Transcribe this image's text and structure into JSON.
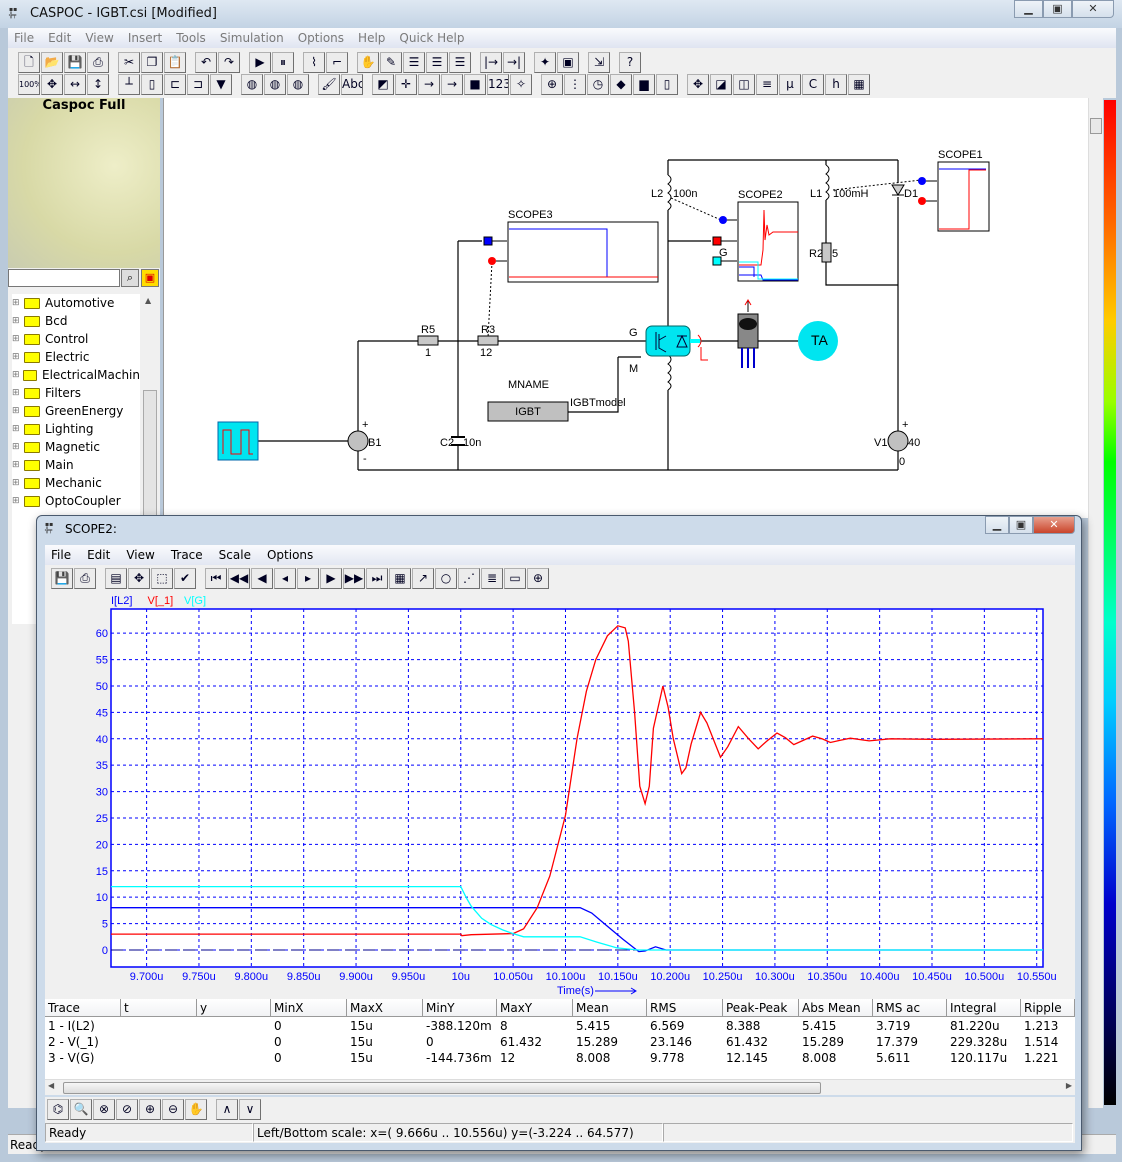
{
  "app": {
    "title": "CASPOC - IGBT.csi [Modified]",
    "window_buttons": [
      "minimize",
      "maximize",
      "close"
    ],
    "menu": [
      "File",
      "Edit",
      "View",
      "Insert",
      "Tools",
      "Simulation",
      "Options",
      "Help",
      "Quick Help"
    ],
    "toolbar_row1": [
      "new-file",
      "open-folder",
      "save",
      "print",
      "|",
      "cut",
      "copy",
      "paste",
      "|",
      "undo",
      "redo",
      "|",
      "run",
      "pause",
      "|",
      "waveform",
      "signal",
      "|",
      "hand",
      "draw",
      "list",
      "list-2",
      "list-3",
      "|",
      "connect-in",
      "connect-out",
      "|",
      "wizard",
      "open-2",
      "|",
      "export",
      "|",
      "help"
    ],
    "toolbar_row2": [
      "zoom-100",
      "fit",
      "fit-width",
      "fit-height",
      "|",
      "ground",
      "resistor",
      "component-a",
      "component-b",
      "probe",
      "|",
      "globe-1",
      "globe-2",
      "globe-3",
      "|",
      "brush",
      "text",
      "|",
      "color",
      "node",
      "wire-1",
      "wire-2",
      "block",
      "label-123",
      "magic",
      "|",
      "crosshair",
      "grid",
      "clock",
      "fill",
      "bar-1",
      "bar-2",
      "|",
      "zoom-fit",
      "overlay",
      "scope-settings",
      "align",
      "chip-m",
      "chip-c",
      "chip-h",
      "table"
    ],
    "status": "Ready",
    "accent_colors": {
      "trace_current": "#0000ff",
      "trace_voltage": "#ff0000",
      "trace_gate": "#00ffff",
      "grid": "#0000ff"
    }
  },
  "sidebar": {
    "title": "Caspoc Full",
    "search_value": "",
    "tree": [
      "Automotive",
      "Bcd",
      "Control",
      "Electric",
      "ElectricalMachin",
      "Filters",
      "GreenEnergy",
      "Lighting",
      "Magnetic",
      "Main",
      "Mechanic",
      "OptoCoupler"
    ]
  },
  "schematic": {
    "labels": {
      "scope1": "SCOPE1",
      "scope2": "SCOPE2",
      "scope3": "SCOPE3",
      "l2": "L2",
      "l2_value": "100n",
      "l1": "L1",
      "l1_value": "100mH",
      "d1": "D1",
      "r2": "R2",
      "r2_value": "5",
      "r5": "R5",
      "r5_value": "1",
      "r3": "R3",
      "r3_value": "12",
      "g": "G",
      "g2": "G",
      "m": "M",
      "mname": "MNAME",
      "igbt_block": "IGBT",
      "igbt_model": "IGBTmodel",
      "b1": "B1",
      "c2": "C2",
      "c2_value": "10n",
      "v1": "V1",
      "v1_value": "40",
      "plus": "+",
      "minus": "-",
      "zero": "0",
      "ta": "TA"
    }
  },
  "scope": {
    "title": "SCOPE2:",
    "menu": [
      "File",
      "Edit",
      "View",
      "Trace",
      "Scale",
      "Options"
    ],
    "toolbar": [
      "save",
      "print",
      "|",
      "trace-select",
      "fit",
      "select-box",
      "check",
      "|",
      "first",
      "fast-back",
      "back",
      "step-back",
      "step-forward",
      "forward",
      "fast-forward",
      "last",
      "table",
      "graph-yt",
      "graph-xy",
      "graph-dots",
      "list-view",
      "window",
      "crosshair"
    ],
    "bottom_toolbar": [
      "binoculars",
      "zoom",
      "zoom-x",
      "zoom-y",
      "zoom-in",
      "zoom-out",
      "pan",
      "|",
      "peak-max",
      "peak-min"
    ],
    "status_left": "Ready",
    "status_scale": "Left/Bottom scale:  x=( 9.666u .. 10.556u) y=(-3.224 .. 64.577)",
    "table": {
      "columns": [
        "Trace",
        "t",
        "y",
        "MinX",
        "MaxX",
        "MinY",
        "MaxY",
        "Mean",
        "RMS",
        "Peak-Peak",
        "Abs Mean",
        "RMS ac",
        "Integral",
        "Ripple"
      ],
      "rows": [
        [
          "1 - I(L2)",
          "",
          "",
          "0",
          "15u",
          "-388.120m",
          "8",
          "5.415",
          "6.569",
          "8.388",
          "5.415",
          "3.719",
          "81.220u",
          "1.213"
        ],
        [
          "2 - V(_1)",
          "",
          "",
          "0",
          "15u",
          "0",
          "61.432",
          "15.289",
          "23.146",
          "61.432",
          "15.289",
          "17.379",
          "229.328u",
          "1.514"
        ],
        [
          "3 - V(G)",
          "",
          "",
          "0",
          "15u",
          "-144.736m",
          "12",
          "8.008",
          "9.778",
          "12.145",
          "8.008",
          "5.611",
          "120.117u",
          "1.221"
        ]
      ]
    }
  },
  "chart_data": {
    "type": "line",
    "xlabel": "Time(s)",
    "xlim": [
      9.666,
      10.556
    ],
    "ylim": [
      -3.224,
      64.577
    ],
    "x_unit_suffix": "u",
    "grid": true,
    "legend_placement": "top-left",
    "x_ticks": [
      "9.700u",
      "9.750u",
      "9.800u",
      "9.850u",
      "9.900u",
      "9.950u",
      "10u",
      "10.050u",
      "10.100u",
      "10.150u",
      "10.200u",
      "10.250u",
      "10.300u",
      "10.350u",
      "10.400u",
      "10.450u",
      "10.500u",
      "10.550u"
    ],
    "y_ticks": [
      "0",
      "5",
      "10",
      "15",
      "20",
      "25",
      "30",
      "35",
      "40",
      "45",
      "50",
      "55",
      "60"
    ],
    "series": [
      {
        "name": "I[L2]",
        "color": "#0000ff",
        "points": [
          [
            9.666,
            8
          ],
          [
            10.114,
            8
          ],
          [
            10.125,
            7
          ],
          [
            10.14,
            4.5
          ],
          [
            10.155,
            2
          ],
          [
            10.17,
            -0.3
          ],
          [
            10.176,
            -0.2
          ],
          [
            10.186,
            0.6
          ],
          [
            10.196,
            0
          ],
          [
            10.556,
            0
          ]
        ]
      },
      {
        "name": "V[_1]",
        "color": "#ff0000",
        "points": [
          [
            9.666,
            3
          ],
          [
            10.0,
            3
          ],
          [
            10.001,
            2.7
          ],
          [
            10.01,
            2.9
          ],
          [
            10.05,
            3.1
          ],
          [
            10.06,
            4
          ],
          [
            10.073,
            8
          ],
          [
            10.085,
            14
          ],
          [
            10.1,
            25.5
          ],
          [
            10.111,
            40
          ],
          [
            10.12,
            49
          ],
          [
            10.129,
            55
          ],
          [
            10.14,
            59.5
          ],
          [
            10.15,
            61.4
          ],
          [
            10.157,
            61
          ],
          [
            10.16,
            58.5
          ],
          [
            10.166,
            45
          ],
          [
            10.171,
            31
          ],
          [
            10.176,
            27.7
          ],
          [
            10.18,
            31
          ],
          [
            10.184,
            42
          ],
          [
            10.193,
            50
          ],
          [
            10.198,
            46
          ],
          [
            10.203,
            40
          ],
          [
            10.211,
            33.4
          ],
          [
            10.215,
            34.5
          ],
          [
            10.22,
            39
          ],
          [
            10.229,
            45
          ],
          [
            10.235,
            43
          ],
          [
            10.248,
            36.5
          ],
          [
            10.255,
            38.5
          ],
          [
            10.265,
            42.3
          ],
          [
            10.275,
            40
          ],
          [
            10.284,
            38.1
          ],
          [
            10.292,
            39.5
          ],
          [
            10.302,
            41.1
          ],
          [
            10.31,
            40.2
          ],
          [
            10.318,
            38.9
          ],
          [
            10.326,
            39.6
          ],
          [
            10.336,
            40.5
          ],
          [
            10.345,
            40
          ],
          [
            10.353,
            39.3
          ],
          [
            10.362,
            39.7
          ],
          [
            10.372,
            40.1
          ],
          [
            10.39,
            39.6
          ],
          [
            10.41,
            40
          ],
          [
            10.45,
            39.9
          ],
          [
            10.556,
            40
          ]
        ]
      },
      {
        "name": "V[G]",
        "color": "#00ffff",
        "points": [
          [
            9.666,
            12
          ],
          [
            10.0,
            12
          ],
          [
            10.005,
            10
          ],
          [
            10.01,
            8.3
          ],
          [
            10.02,
            6
          ],
          [
            10.029,
            4.8
          ],
          [
            10.04,
            3.8
          ],
          [
            10.05,
            3.1
          ],
          [
            10.06,
            2.5
          ],
          [
            10.114,
            2.5
          ],
          [
            10.13,
            1.5
          ],
          [
            10.149,
            0.4
          ],
          [
            10.17,
            0
          ],
          [
            10.556,
            0
          ]
        ]
      }
    ]
  }
}
